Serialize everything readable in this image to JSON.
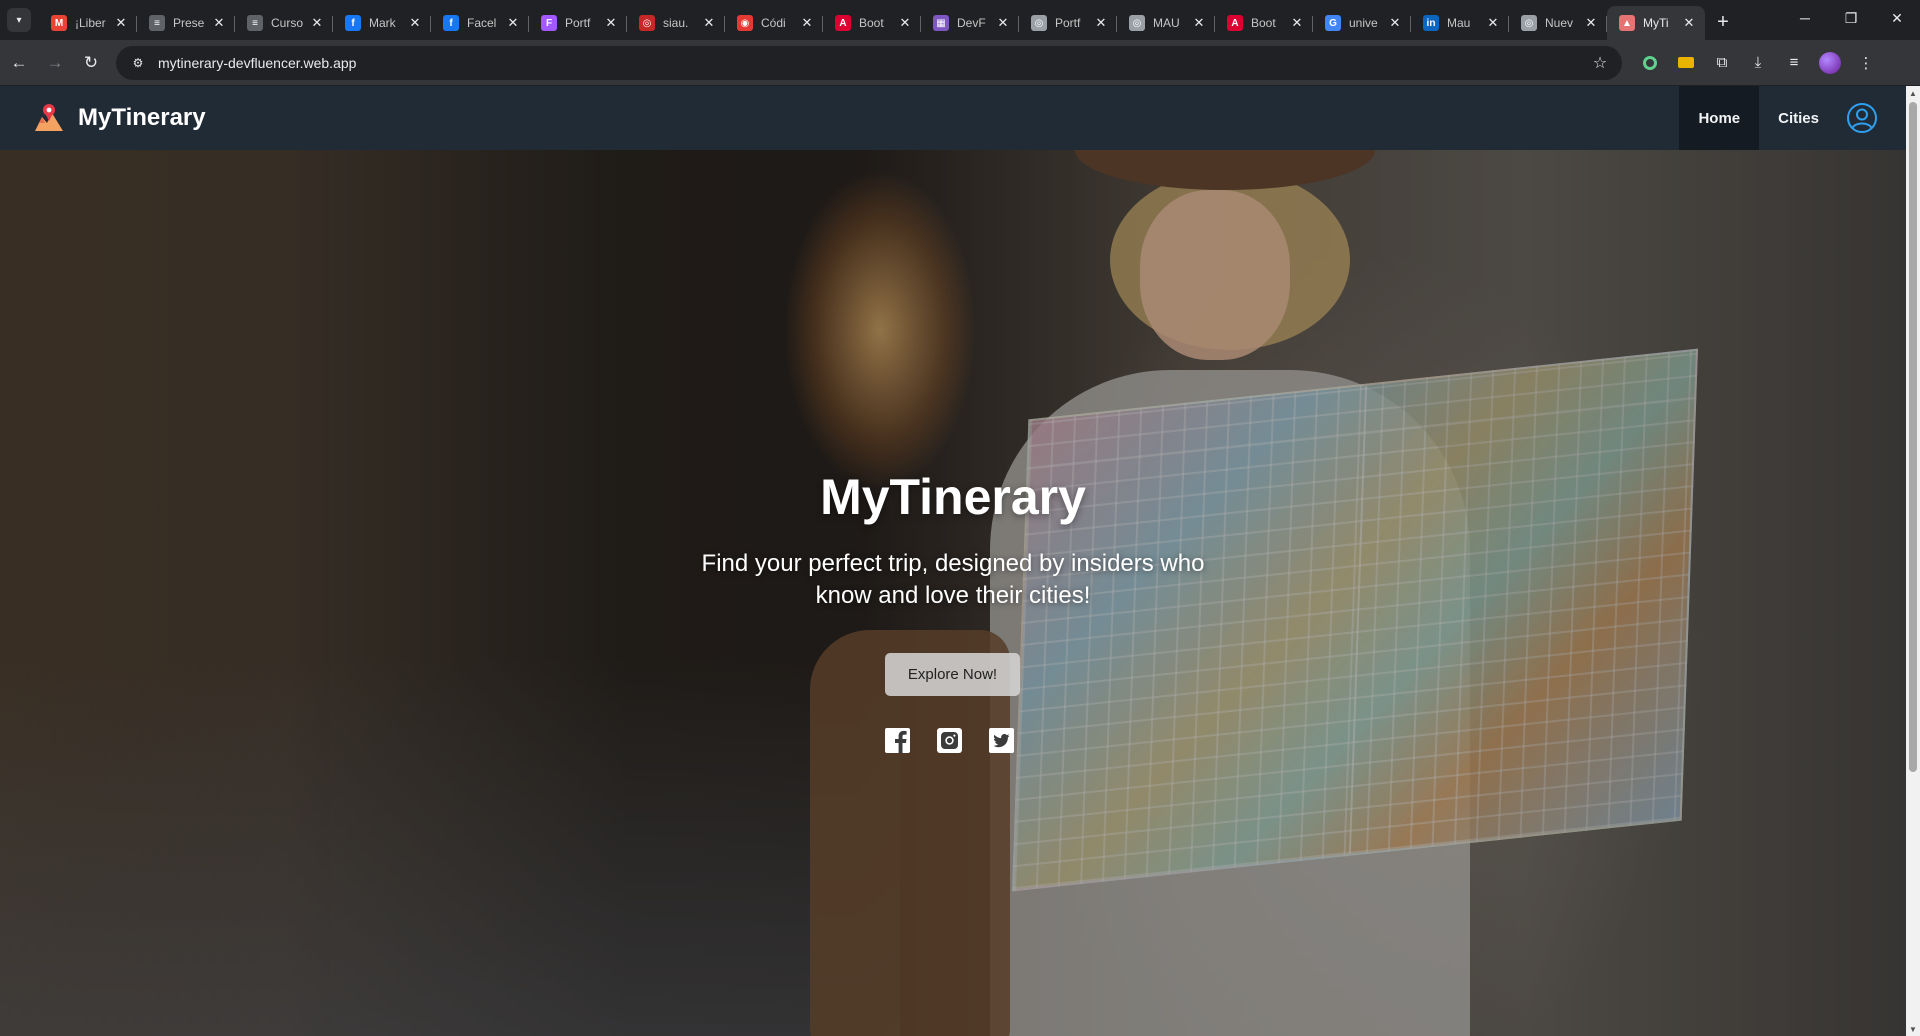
{
  "browser": {
    "tabs": [
      {
        "title": "¡Liber",
        "icon": "gmail-icon",
        "color": "#ea4335",
        "glyph": "M",
        "active": false
      },
      {
        "title": "Prese",
        "icon": "docs-icon",
        "color": "#5f6368",
        "glyph": "≡",
        "active": false
      },
      {
        "title": "Curso",
        "icon": "docs-icon",
        "color": "#5f6368",
        "glyph": "≡",
        "active": false
      },
      {
        "title": "Mark",
        "icon": "facebook-icon",
        "color": "#1877f2",
        "glyph": "f",
        "active": false
      },
      {
        "title": "Facel",
        "icon": "facebook-icon",
        "color": "#1877f2",
        "glyph": "f",
        "active": false
      },
      {
        "title": "Portf",
        "icon": "figma-icon",
        "color": "#a259ff",
        "glyph": "F",
        "active": false
      },
      {
        "title": "siau.",
        "icon": "siau-icon",
        "color": "#c62828",
        "glyph": "◎",
        "active": false
      },
      {
        "title": "Códi",
        "icon": "code-icon",
        "color": "#e53935",
        "glyph": "◉",
        "active": false
      },
      {
        "title": "Boot",
        "icon": "angular-icon",
        "color": "#dd0031",
        "glyph": "A",
        "active": false
      },
      {
        "title": "DevF",
        "icon": "devf-icon",
        "color": "#7e57c2",
        "glyph": "▦",
        "active": false
      },
      {
        "title": "Portf",
        "icon": "globe-icon",
        "color": "#9aa0a6",
        "glyph": "◎",
        "active": false
      },
      {
        "title": "MAU",
        "icon": "globe-icon",
        "color": "#9aa0a6",
        "glyph": "◎",
        "active": false
      },
      {
        "title": "Boot",
        "icon": "angular-icon",
        "color": "#dd0031",
        "glyph": "A",
        "active": false
      },
      {
        "title": "unive",
        "icon": "google-icon",
        "color": "#4285f4",
        "glyph": "G",
        "active": false
      },
      {
        "title": "Mau",
        "icon": "linkedin-icon",
        "color": "#0a66c2",
        "glyph": "in",
        "active": false
      },
      {
        "title": "Nuev",
        "icon": "globe-icon",
        "color": "#9aa0a6",
        "glyph": "◎",
        "active": false
      },
      {
        "title": "MyTi",
        "icon": "mytinerary-favicon",
        "color": "#e57373",
        "glyph": "▲",
        "active": true
      }
    ],
    "close_glyph": "✕",
    "new_tab_glyph": "+",
    "window": {
      "minimize": "─",
      "restore": "❐",
      "close": "✕"
    },
    "nav": {
      "back": "←",
      "forward": "→",
      "reload": "↻"
    },
    "url": "mytinerary-devfluencer.web.app",
    "star": "☆"
  },
  "site": {
    "brand": "MyTinerary",
    "nav_links": [
      {
        "label": "Home",
        "active": true
      },
      {
        "label": "Cities",
        "active": false
      }
    ],
    "hero": {
      "title": "MyTinerary",
      "subtitle": "Find your perfect trip, designed by insiders who know and love their cities!",
      "cta": "Explore Now!"
    },
    "socials": [
      "facebook-icon",
      "instagram-icon",
      "twitter-icon"
    ],
    "colors": {
      "navbar": "#212b36",
      "active_link": "#141b23",
      "user_icon": "#2ea0f0"
    }
  }
}
